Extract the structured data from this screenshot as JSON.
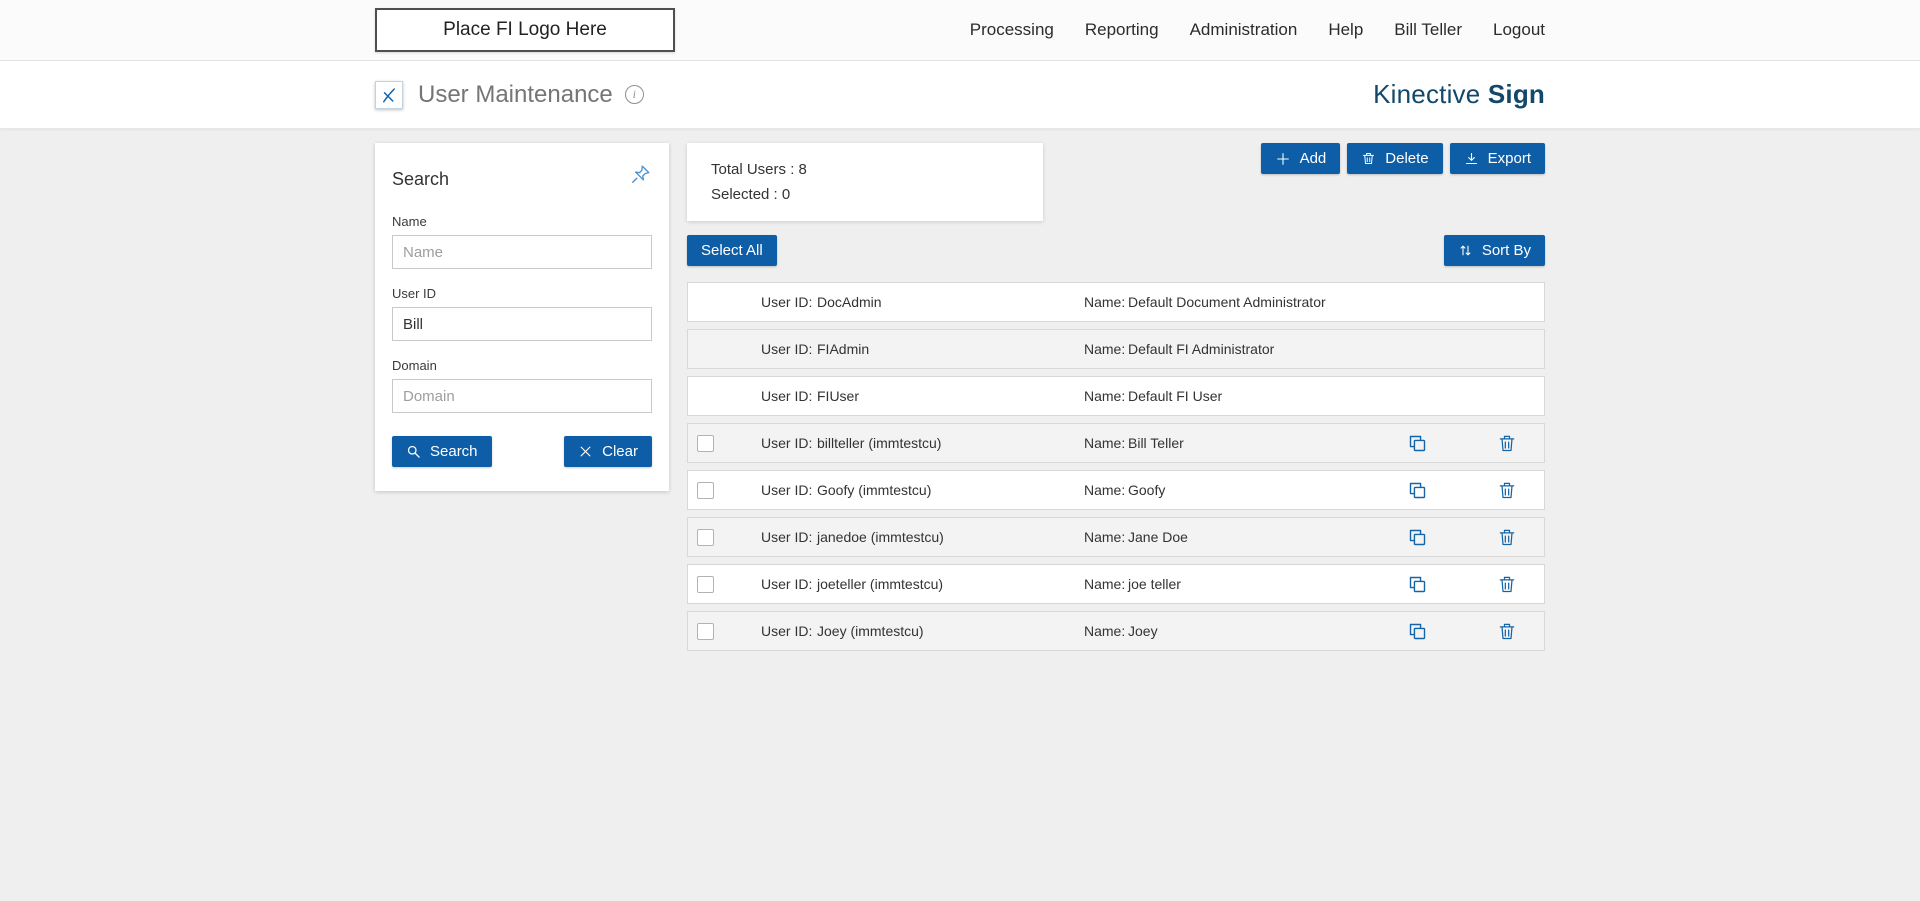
{
  "colors": {
    "primary": "#0e5ea7",
    "icon_blue": "#1465a7",
    "brand": "#12486b",
    "page_bg": "#efefef"
  },
  "top_nav": {
    "logo_placeholder": "Place FI Logo Here",
    "items": [
      "Processing",
      "Reporting",
      "Administration",
      "Help",
      "Bill Teller",
      "Logout"
    ]
  },
  "header": {
    "title": "User Maintenance",
    "brand_first": "Kinective",
    "brand_second": "Sign"
  },
  "search_panel": {
    "title": "Search",
    "name_label": "Name",
    "name_placeholder": "Name",
    "user_id_label": "User ID",
    "user_id_value": "Bill",
    "domain_label": "Domain",
    "domain_placeholder": "Domain",
    "search_label": "Search",
    "clear_label": "Clear"
  },
  "summary": {
    "total_text": "Total Users : 8",
    "selected_text": "Selected : 0"
  },
  "toolbar": {
    "add_label": "Add",
    "delete_label": "Delete",
    "export_label": "Export",
    "select_all_label": "Select All",
    "sort_by_label": "Sort By"
  },
  "users": {
    "id_label": "User ID:",
    "name_label": "Name:",
    "rows": [
      {
        "user_id": "DocAdmin",
        "name": "Default Document Administrator",
        "actions": false
      },
      {
        "user_id": "FIAdmin",
        "name": "Default FI Administrator",
        "actions": false
      },
      {
        "user_id": "FIUser",
        "name": "Default FI User",
        "actions": false
      },
      {
        "user_id": "billteller (immtestcu)",
        "name": "Bill Teller",
        "actions": true
      },
      {
        "user_id": "Goofy (immtestcu)",
        "name": "Goofy",
        "actions": true
      },
      {
        "user_id": "janedoe (immtestcu)",
        "name": "Jane Doe",
        "actions": true
      },
      {
        "user_id": "joeteller (immtestcu)",
        "name": "joe teller",
        "actions": true
      },
      {
        "user_id": "Joey (immtestcu)",
        "name": "Joey",
        "actions": true
      }
    ]
  }
}
